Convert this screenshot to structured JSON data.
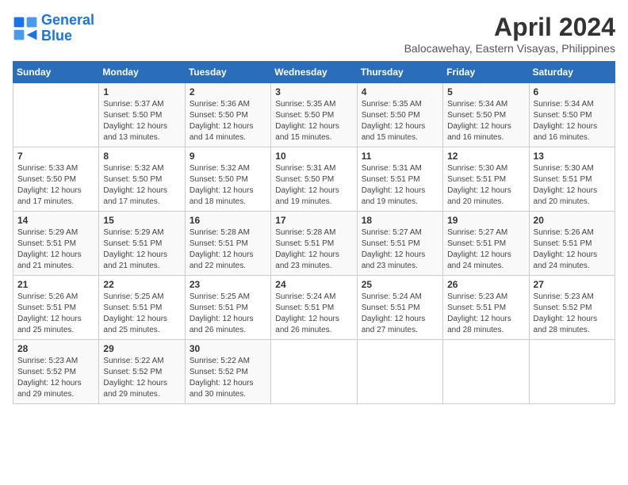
{
  "logo": {
    "line1": "General",
    "line2": "Blue"
  },
  "title": "April 2024",
  "subtitle": "Balocawehay, Eastern Visayas, Philippines",
  "days_header": [
    "Sunday",
    "Monday",
    "Tuesday",
    "Wednesday",
    "Thursday",
    "Friday",
    "Saturday"
  ],
  "weeks": [
    [
      {
        "day": "",
        "sunrise": "",
        "sunset": "",
        "daylight": ""
      },
      {
        "day": "1",
        "sunrise": "Sunrise: 5:37 AM",
        "sunset": "Sunset: 5:50 PM",
        "daylight": "Daylight: 12 hours and 13 minutes."
      },
      {
        "day": "2",
        "sunrise": "Sunrise: 5:36 AM",
        "sunset": "Sunset: 5:50 PM",
        "daylight": "Daylight: 12 hours and 14 minutes."
      },
      {
        "day": "3",
        "sunrise": "Sunrise: 5:35 AM",
        "sunset": "Sunset: 5:50 PM",
        "daylight": "Daylight: 12 hours and 15 minutes."
      },
      {
        "day": "4",
        "sunrise": "Sunrise: 5:35 AM",
        "sunset": "Sunset: 5:50 PM",
        "daylight": "Daylight: 12 hours and 15 minutes."
      },
      {
        "day": "5",
        "sunrise": "Sunrise: 5:34 AM",
        "sunset": "Sunset: 5:50 PM",
        "daylight": "Daylight: 12 hours and 16 minutes."
      },
      {
        "day": "6",
        "sunrise": "Sunrise: 5:34 AM",
        "sunset": "Sunset: 5:50 PM",
        "daylight": "Daylight: 12 hours and 16 minutes."
      }
    ],
    [
      {
        "day": "7",
        "sunrise": "Sunrise: 5:33 AM",
        "sunset": "Sunset: 5:50 PM",
        "daylight": "Daylight: 12 hours and 17 minutes."
      },
      {
        "day": "8",
        "sunrise": "Sunrise: 5:32 AM",
        "sunset": "Sunset: 5:50 PM",
        "daylight": "Daylight: 12 hours and 17 minutes."
      },
      {
        "day": "9",
        "sunrise": "Sunrise: 5:32 AM",
        "sunset": "Sunset: 5:50 PM",
        "daylight": "Daylight: 12 hours and 18 minutes."
      },
      {
        "day": "10",
        "sunrise": "Sunrise: 5:31 AM",
        "sunset": "Sunset: 5:50 PM",
        "daylight": "Daylight: 12 hours and 19 minutes."
      },
      {
        "day": "11",
        "sunrise": "Sunrise: 5:31 AM",
        "sunset": "Sunset: 5:51 PM",
        "daylight": "Daylight: 12 hours and 19 minutes."
      },
      {
        "day": "12",
        "sunrise": "Sunrise: 5:30 AM",
        "sunset": "Sunset: 5:51 PM",
        "daylight": "Daylight: 12 hours and 20 minutes."
      },
      {
        "day": "13",
        "sunrise": "Sunrise: 5:30 AM",
        "sunset": "Sunset: 5:51 PM",
        "daylight": "Daylight: 12 hours and 20 minutes."
      }
    ],
    [
      {
        "day": "14",
        "sunrise": "Sunrise: 5:29 AM",
        "sunset": "Sunset: 5:51 PM",
        "daylight": "Daylight: 12 hours and 21 minutes."
      },
      {
        "day": "15",
        "sunrise": "Sunrise: 5:29 AM",
        "sunset": "Sunset: 5:51 PM",
        "daylight": "Daylight: 12 hours and 21 minutes."
      },
      {
        "day": "16",
        "sunrise": "Sunrise: 5:28 AM",
        "sunset": "Sunset: 5:51 PM",
        "daylight": "Daylight: 12 hours and 22 minutes."
      },
      {
        "day": "17",
        "sunrise": "Sunrise: 5:28 AM",
        "sunset": "Sunset: 5:51 PM",
        "daylight": "Daylight: 12 hours and 23 minutes."
      },
      {
        "day": "18",
        "sunrise": "Sunrise: 5:27 AM",
        "sunset": "Sunset: 5:51 PM",
        "daylight": "Daylight: 12 hours and 23 minutes."
      },
      {
        "day": "19",
        "sunrise": "Sunrise: 5:27 AM",
        "sunset": "Sunset: 5:51 PM",
        "daylight": "Daylight: 12 hours and 24 minutes."
      },
      {
        "day": "20",
        "sunrise": "Sunrise: 5:26 AM",
        "sunset": "Sunset: 5:51 PM",
        "daylight": "Daylight: 12 hours and 24 minutes."
      }
    ],
    [
      {
        "day": "21",
        "sunrise": "Sunrise: 5:26 AM",
        "sunset": "Sunset: 5:51 PM",
        "daylight": "Daylight: 12 hours and 25 minutes."
      },
      {
        "day": "22",
        "sunrise": "Sunrise: 5:25 AM",
        "sunset": "Sunset: 5:51 PM",
        "daylight": "Daylight: 12 hours and 25 minutes."
      },
      {
        "day": "23",
        "sunrise": "Sunrise: 5:25 AM",
        "sunset": "Sunset: 5:51 PM",
        "daylight": "Daylight: 12 hours and 26 minutes."
      },
      {
        "day": "24",
        "sunrise": "Sunrise: 5:24 AM",
        "sunset": "Sunset: 5:51 PM",
        "daylight": "Daylight: 12 hours and 26 minutes."
      },
      {
        "day": "25",
        "sunrise": "Sunrise: 5:24 AM",
        "sunset": "Sunset: 5:51 PM",
        "daylight": "Daylight: 12 hours and 27 minutes."
      },
      {
        "day": "26",
        "sunrise": "Sunrise: 5:23 AM",
        "sunset": "Sunset: 5:51 PM",
        "daylight": "Daylight: 12 hours and 28 minutes."
      },
      {
        "day": "27",
        "sunrise": "Sunrise: 5:23 AM",
        "sunset": "Sunset: 5:52 PM",
        "daylight": "Daylight: 12 hours and 28 minutes."
      }
    ],
    [
      {
        "day": "28",
        "sunrise": "Sunrise: 5:23 AM",
        "sunset": "Sunset: 5:52 PM",
        "daylight": "Daylight: 12 hours and 29 minutes."
      },
      {
        "day": "29",
        "sunrise": "Sunrise: 5:22 AM",
        "sunset": "Sunset: 5:52 PM",
        "daylight": "Daylight: 12 hours and 29 minutes."
      },
      {
        "day": "30",
        "sunrise": "Sunrise: 5:22 AM",
        "sunset": "Sunset: 5:52 PM",
        "daylight": "Daylight: 12 hours and 30 minutes."
      },
      {
        "day": "",
        "sunrise": "",
        "sunset": "",
        "daylight": ""
      },
      {
        "day": "",
        "sunrise": "",
        "sunset": "",
        "daylight": ""
      },
      {
        "day": "",
        "sunrise": "",
        "sunset": "",
        "daylight": ""
      },
      {
        "day": "",
        "sunrise": "",
        "sunset": "",
        "daylight": ""
      }
    ]
  ]
}
